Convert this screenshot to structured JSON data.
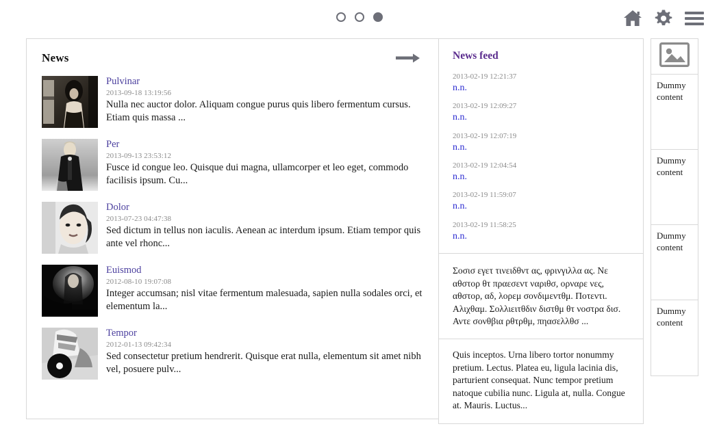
{
  "topbar": {
    "dots": [
      {
        "name": "slide-1",
        "active": false
      },
      {
        "name": "slide-2",
        "active": false
      },
      {
        "name": "slide-3",
        "active": true
      }
    ],
    "icons": [
      {
        "name": "home-icon",
        "label": "Home"
      },
      {
        "name": "gear-icon",
        "label": "Settings"
      },
      {
        "name": "hamburger-menu-icon",
        "label": "Menu"
      }
    ],
    "icon_color": "#6d6f78"
  },
  "news": {
    "title": "News",
    "more_arrow": "⟶",
    "items": [
      {
        "title": "Pulvinar",
        "date": "2013-09-18 13:19:56",
        "text": "Nulla nec auctor dolor. Aliquam congue purus quis libero fermentum cursus. Etiam quis massa ..."
      },
      {
        "title": "Per",
        "date": "2013-09-13 23:53:12",
        "text": "Fusce id congue leo. Quisque dui magna, ullamcorper et leo eget, commodo facilisis ipsum. Cu..."
      },
      {
        "title": "Dolor",
        "date": "2013-07-23 04:47:38",
        "text": "Sed dictum in tellus non iaculis. Aenean ac interdum ipsum. Etiam tempor quis ante vel rhonc..."
      },
      {
        "title": "Euismod",
        "date": "2012-08-10 19:07:08",
        "text": "Integer accumsan; nisl vitae fermentum malesuada, sapien nulla sodales orci, et elementum la..."
      },
      {
        "title": "Tempor",
        "date": "2012-01-13 09:42:34",
        "text": "Sed consectetur pretium hendrerit. Quisque erat nulla, elementum sit amet nibh vel, posuere pulv..."
      }
    ],
    "link_color": "#4b3f9e"
  },
  "feed": {
    "title": "News feed",
    "title_color": "#5b2d8e",
    "link_color": "#2b2bd0",
    "entries": [
      {
        "date": "2013-02-19 12:21:37",
        "link": "n.n."
      },
      {
        "date": "2013-02-19 12:09:27",
        "link": "n.n."
      },
      {
        "date": "2013-02-19 12:07:19",
        "link": "n.n."
      },
      {
        "date": "2013-02-19 12:04:54",
        "link": "n.n."
      },
      {
        "date": "2013-02-19 11:59:07",
        "link": "n.n."
      },
      {
        "date": "2013-02-19 11:58:25",
        "link": "n.n."
      }
    ],
    "greek_paragraph": "Σοσισ εγετ τινειδθντ ας, φρινγιλλα ας. Νε αθστορ θτ πραεσεντ ναριθσ, ορναρε νες, αθστορ, αδ, λορεμ σονδιμεντθμ. Ποτεντι. Αλιχθαμ. Σολλιειτθδιν διστθμ θτ νοστρα δισ. Αντε σονθβια ρθτρθμ, πηασελλθσ ...",
    "latin_paragraph": "Quis inceptos. Urna libero tortor nonummy pretium. Lectus. Platea eu, ligula lacinia dis, parturient consequat. Nunc tempor pretium natoque cubilia nunc. Ligula at, nulla. Congue at. Mauris. Luctus..."
  },
  "aside": {
    "image_placeholder_name": "image-placeholder-icon",
    "blocks": [
      {
        "text": "Dummy content"
      },
      {
        "text": "Dummy content"
      },
      {
        "text": "Dummy content"
      },
      {
        "text": "Dummy content"
      }
    ]
  }
}
